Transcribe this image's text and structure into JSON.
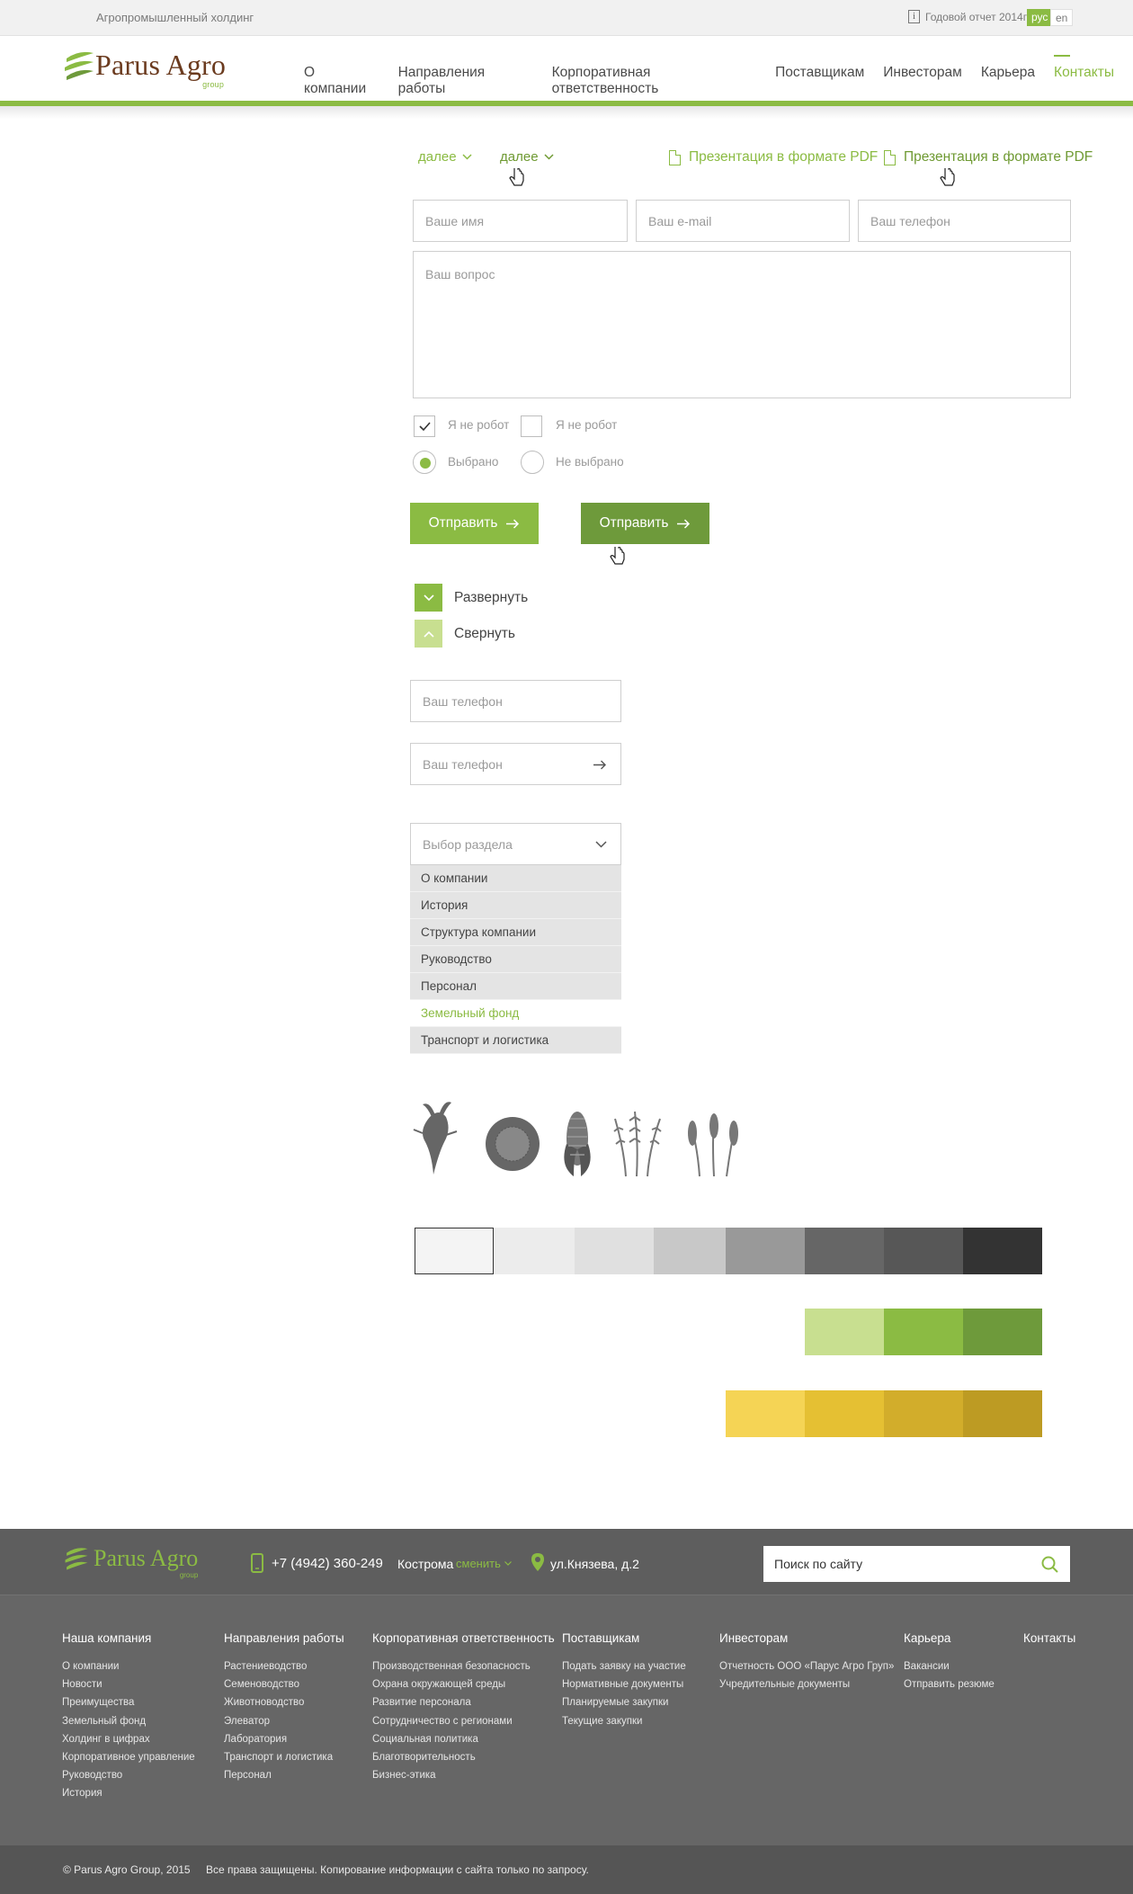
{
  "topbar": {
    "tagline": "Агропромышленный холдинг",
    "report": "Годовой отчет 2014г",
    "report_icon": "i",
    "lang_ru": "рус",
    "lang_en": "en"
  },
  "header": {
    "logo": "Parus Agro",
    "logo_sub": "group",
    "nav": [
      "О компании",
      "Направления работы",
      "Корпоративная ответственность",
      "Поставщикам",
      "Инвесторам",
      "Карьера",
      "Контакты"
    ]
  },
  "links": {
    "more": "далее",
    "more_hover": "далее",
    "pdf": "Презентация в формате PDF",
    "pdf_hover": "Презентация в формате PDF"
  },
  "form": {
    "name_placeholder": "Ваше имя",
    "email_placeholder": "Ваш e-mail",
    "phone_placeholder": "Ваш телефон",
    "question_placeholder": "Ваш вопрос",
    "robot_checked": "Я не робот",
    "robot_unchecked": "Я не робот",
    "radio_selected": "Выбрано",
    "radio_unselected": "Не выбрано",
    "submit": "Отправить",
    "submit_hover": "Отправить",
    "expand": "Развернуть",
    "collapse": "Свернуть",
    "phone2_placeholder": "Ваш телефон",
    "phone3_placeholder": "Ваш телефон"
  },
  "select": {
    "placeholder": "Выбор раздела",
    "options": [
      "О компании",
      "История",
      "Структура компании",
      "Руководство",
      "Персонал",
      "Земельный фонд",
      "Транспорт и логистика"
    ],
    "selected_index": 5
  },
  "icons": [
    "beet-icon",
    "sunflower-icon",
    "corn-icon",
    "wheat-icon",
    "barley-icon"
  ],
  "palette": {
    "grays": [
      "#f4f4f4",
      "#ececec",
      "#e0e0e0",
      "#c8c8c8",
      "#999999",
      "#666666",
      "#575757",
      "#333333"
    ],
    "greens": [
      "#c8df90",
      "#8bbb43",
      "#6e9a3b"
    ],
    "yellows": [
      "#f5d455",
      "#e5c033",
      "#d2ad2b",
      "#bd9b23"
    ]
  },
  "footer": {
    "logo": "Parus Agro",
    "logo_sub": "group",
    "phone": "+7 (4942) 360-249",
    "city": "Кострома",
    "change": "сменить",
    "address": "ул.Князева, д.2",
    "search_placeholder": "Поиск по сайту",
    "columns": [
      {
        "title": "Наша компания",
        "links": [
          "О компании",
          "Новости",
          "Преимущества",
          "Земельный фонд",
          "Холдинг в цифрах",
          "Корпоративное управление",
          "Руководство",
          "История"
        ]
      },
      {
        "title": "Направления работы",
        "links": [
          "Растениеводство",
          "Семеноводство",
          "Животноводство",
          "Элеватор",
          "Лаборатория",
          "Транспорт и логистика",
          "Персонал"
        ]
      },
      {
        "title": "Корпоративная ответственность",
        "links": [
          "Производственная безопасность",
          "Охрана окружающей среды",
          "Развитие персонала",
          "Сотрудничество с регионами",
          "Социальная политика",
          "Благотворительность",
          "Бизнес-этика"
        ]
      },
      {
        "title": "Поставщикам",
        "links": [
          "Подать заявку на участие",
          "Нормативные документы",
          "Планируемые закупки",
          "Текущие закупки"
        ]
      },
      {
        "title": "Инвесторам",
        "links": [
          "Отчетность ООО «Парус Агро Груп»",
          "Учредительные документы"
        ]
      },
      {
        "title": "Карьера",
        "links": [
          "Вакансии",
          "Отправить резюме"
        ]
      },
      {
        "title": "Контакты",
        "links": []
      }
    ],
    "copyright": "© Parus Agro Group, 2015",
    "rights": "Все права защищены. Копирование информации с сайта  только по запросу."
  }
}
